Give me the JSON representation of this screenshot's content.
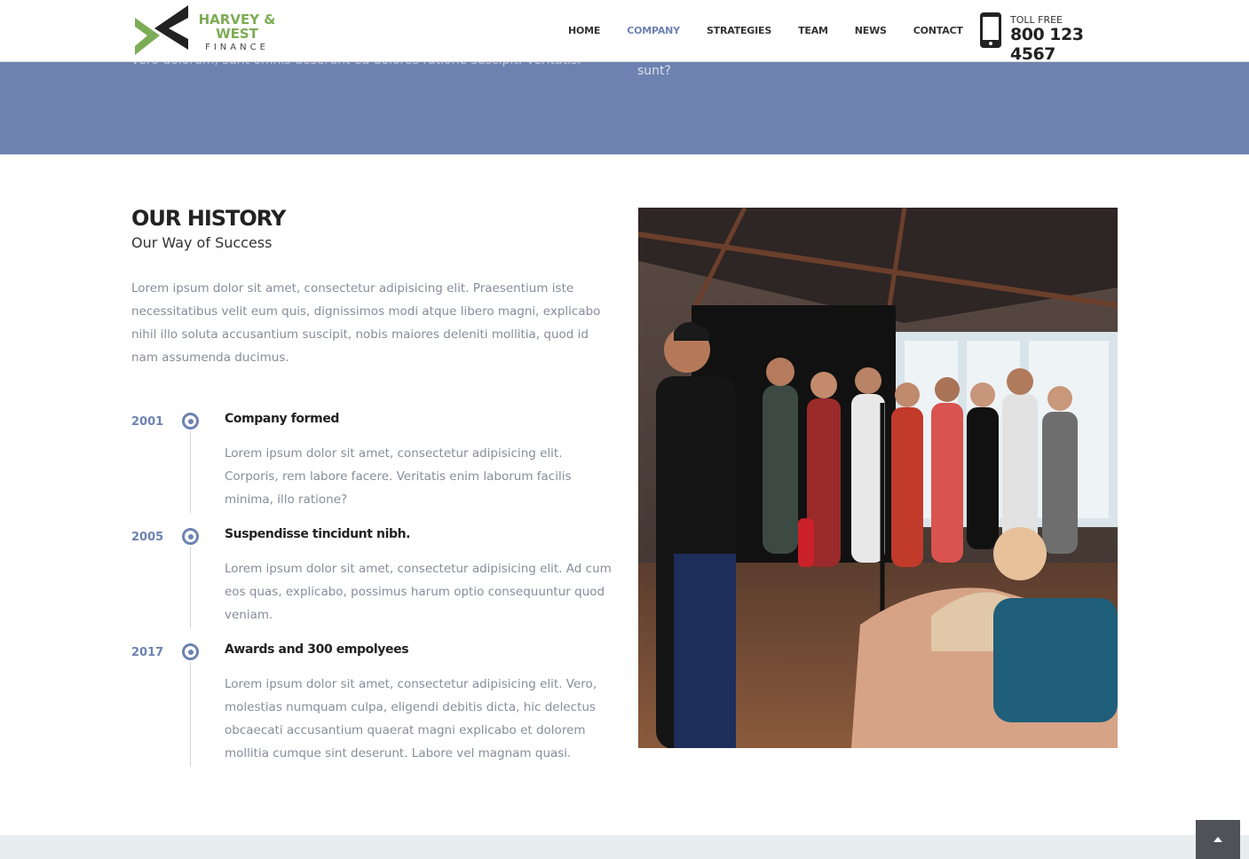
{
  "header": {
    "logo": {
      "line1": "HARVEY &",
      "line2": "WEST",
      "line3": "FINANCE",
      "mark_icon": "harvey-west-logo-mark",
      "colors": {
        "green": "#7eac56",
        "dark": "#222222"
      }
    },
    "nav": [
      {
        "label": "HOME",
        "active": false
      },
      {
        "label": "COMPANY",
        "active": true
      },
      {
        "label": "STRATEGIES",
        "active": false
      },
      {
        "label": "TEAM",
        "active": false
      },
      {
        "label": "NEWS",
        "active": false
      },
      {
        "label": "CONTACT",
        "active": false
      }
    ],
    "phone": {
      "icon": "mobile-phone-icon",
      "label": "TOLL FREE",
      "number": "800 123 4567"
    }
  },
  "previous_section": {
    "left_text": "vero dolorum, sunt omnis deserunt ea dolores ratione suscipit. Veritatis.",
    "right_text": "sunt?",
    "background": "#6d82b1"
  },
  "history": {
    "title": "OUR HISTORY",
    "subtitle": "Our Way of Success",
    "intro": "Lorem ipsum dolor sit amet, consectetur adipisicing elit. Praesentium iste necessitatibus velit eum quis, dignissimos modi atque libero magni, explicabo nihil illo soluta accusantium suscipit, nobis maiores deleniti mollitia, quod id nam assumenda ducimus.",
    "timeline": [
      {
        "year": "2001",
        "heading": "Company formed",
        "text": "Lorem ipsum dolor sit amet, consectetur adipisicing elit. Corporis, rem labore facere. Veritatis enim laborum facilis minima, illo ratione?"
      },
      {
        "year": "2005",
        "heading": "Suspendisse tincidunt nibh.",
        "text": "Lorem ipsum dolor sit amet, consectetur adipisicing elit. Ad cum eos quas, explicabo, possimus harum optio consequuntur quod veniam."
      },
      {
        "year": "2017",
        "heading": "Awards and 300 empolyees",
        "text": "Lorem ipsum dolor sit amet, consectetur adipisicing elit. Vero, molestias numquam culpa, eligendi debitis dicta, hic delectus obcaecati accusantium quaerat magni explicabo et dolorem mollitia cumque sint deserunt. Labore vel magnam quasi."
      }
    ],
    "accent_color": "#6d82b1"
  },
  "photo": {
    "subject": "team-event-photo"
  },
  "back_to_top": {
    "icon": "chevron-up-icon"
  }
}
